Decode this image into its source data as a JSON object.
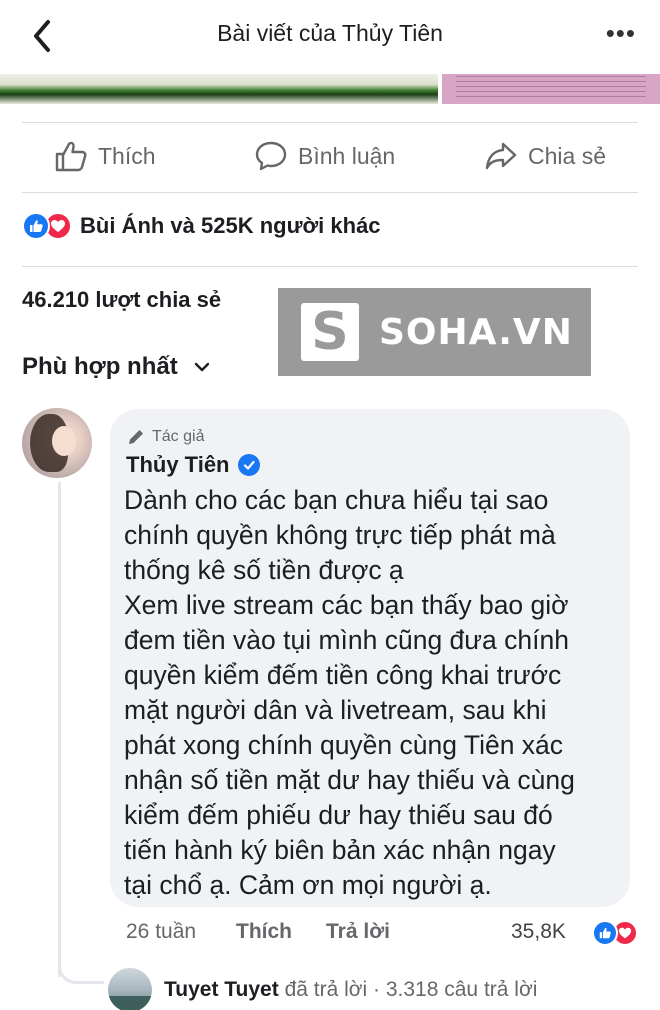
{
  "header": {
    "title": "Bài viết của Thủy Tiên",
    "more_label": "•••"
  },
  "actions": {
    "like": "Thích",
    "comment": "Bình luận",
    "share": "Chia sẻ"
  },
  "reactions": {
    "summary": "Bùi Ánh và 525K người khác"
  },
  "shares": {
    "text": "46.210 lượt chia sẻ"
  },
  "watermark": {
    "logo_letter": "S",
    "text": "SOHA.VN"
  },
  "sort": {
    "label": "Phù hợp nhất"
  },
  "comment": {
    "author_badge": "Tác giả",
    "author_name": "Thủy Tiên",
    "lines": [
      "Dành cho các bạn chưa hiểu tại sao",
      "chính quyền không trực tiếp phát mà",
      "thống kê số tiền được ạ",
      "Xem live stream các bạn thấy bao giờ",
      "đem tiền vào tụi mình cũng đưa chính",
      "quyền kiểm đếm tiền công khai trước",
      "mặt người dân và livetream, sau khi",
      "phát xong chính quyền cùng Tiên xác",
      "nhận số tiền mặt dư hay thiếu và cùng",
      "kiểm đếm phiếu dư hay thiếu sau đó",
      "tiến hành ký biên bản xác nhận ngay",
      "tại chổ ạ. Cảm ơn mọi người ạ."
    ],
    "time": "26 tuần",
    "like_label": "Thích",
    "reply_label": "Trả lời",
    "reaction_count": "35,8K"
  },
  "reply_preview": {
    "name": "Tuyet Tuyet",
    "text": " đã trả lời · 3.318 câu trả lời"
  },
  "colors": {
    "facebook_blue": "#1877f2",
    "love_red": "#f02849",
    "muted_text": "#65676b",
    "bubble_bg": "#f0f2f5"
  }
}
